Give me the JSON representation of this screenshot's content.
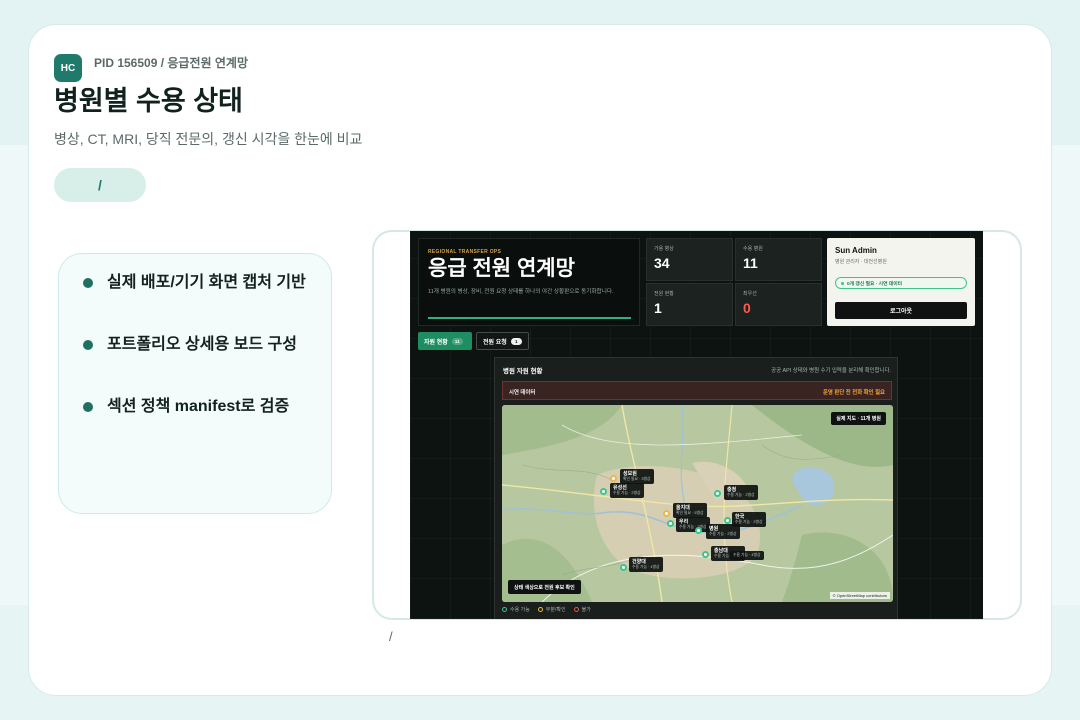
{
  "board": {
    "badge": "HC",
    "pid": "PID 156509 / 응급전원 연계망",
    "title": "병원별 수용 상태",
    "subtitle": "병상, CT, MRI, 당직 전문의, 갱신 시각을 한눈에 비교",
    "pill": "/",
    "caption": "/",
    "bullets": [
      "실제 배포/기기 화면 캡처 기반",
      "포트폴리오 상세용 보드 구성",
      "섹션 정책 manifest로 검증"
    ]
  },
  "app": {
    "eyebrow": "REGIONAL TRANSFER OPS",
    "title": "응급 전원 연계망",
    "description": "11개 병원의 병상, 장비, 전원 요청 상태를 하나의 야간 상황판으로 동기화합니다.",
    "stats": [
      {
        "label": "가용 병상",
        "value": "34",
        "color": "#ffffff"
      },
      {
        "label": "수용 병원",
        "value": "11",
        "color": "#ffffff"
      },
      {
        "label": "전원 현황",
        "value": "1",
        "color": "#ffffff"
      },
      {
        "label": "최우선",
        "value": "0",
        "color": "#ff5b4d"
      }
    ],
    "user": {
      "name": "Sun Admin",
      "role": "병원 관리자 · 대전선병원",
      "status": "0개 갱신 필요 · 시연 데이터",
      "logout": "로그아웃"
    },
    "tabs": [
      {
        "label": "자원 현황",
        "count": "11"
      },
      {
        "label": "전원 요청",
        "count": "1"
      }
    ],
    "panel": {
      "title": "병원 자원 현황",
      "note": "공공 API 상태와 병원 수기 입력을 분리해 확인합니다.",
      "alert_label": "시연 데이터",
      "alert_message": "운영 판단 전 전화 확인 필요"
    },
    "map": {
      "badge": "실제 지도 · 11개 병원",
      "hint": "상태 색상으로 전원 후보 확인",
      "attribution": "© OpenStreetMap contributors",
      "markers": [
        {
          "name": "성모원",
          "detail": "확인 필요 · 3병상",
          "color": "#e9b949"
        },
        {
          "name": "유성선",
          "detail": "수용 가능 · 2병상",
          "color": "#3ec48a"
        },
        {
          "name": "을지대",
          "detail": "확인 필요 · 5병상",
          "color": "#e9b949"
        },
        {
          "name": "우리",
          "detail": "수용 가능 · 2병상",
          "color": "#3ec48a"
        },
        {
          "name": "병원",
          "detail": "수용 가능 · 2병상",
          "color": "#3ec48a"
        },
        {
          "name": "충청",
          "detail": "수용 가능 · 2병상",
          "color": "#3ec48a"
        },
        {
          "name": "한국",
          "detail": "수용 가능 · 2병상",
          "color": "#3ec48a"
        },
        {
          "name": "충남대",
          "detail": "수용 가능 · 3병상",
          "color": "#3ec48a"
        },
        {
          "detail": "수용 가능 · 4병상",
          "color": "#3ec48a"
        },
        {
          "name": "건양대",
          "detail": "수용 가능 · 4병상",
          "color": "#3ec48a"
        }
      ]
    },
    "legend": [
      {
        "label": "수용 가능",
        "color": "#3ec48a"
      },
      {
        "label": "부분/확인",
        "color": "#e9b949"
      },
      {
        "label": "불가",
        "color": "#e0574b"
      }
    ]
  },
  "colors": {
    "accent": "#1f7a6b",
    "bullet": "#1f6f63",
    "progress_line": "#2fb07f",
    "status_dot": "#3ec48a",
    "alert_text": "#f2a33a"
  }
}
